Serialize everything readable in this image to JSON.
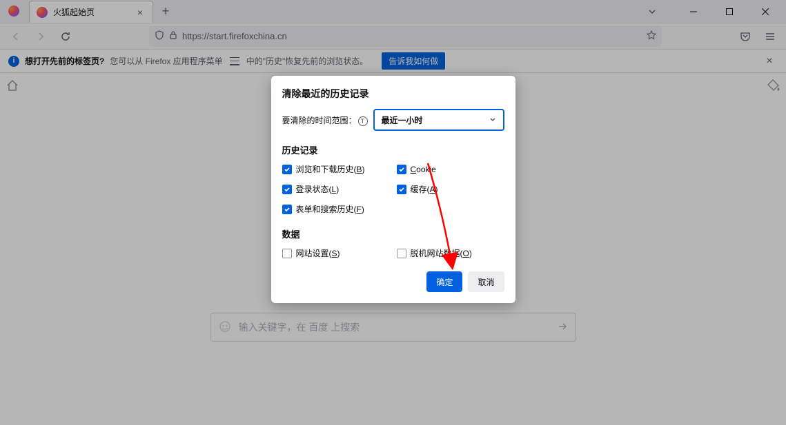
{
  "tab": {
    "title": "火狐起始页"
  },
  "url": "https://start.firefoxchina.cn",
  "notification": {
    "label": "想打开先前的标签页?",
    "text_a": "您可以从 Firefox 应用程序菜单",
    "text_b": "中的\"历史\"恢复先前的浏览状态。",
    "button": "告诉我如何做"
  },
  "search": {
    "placeholder": "输入关键字，在 百度 上搜索"
  },
  "dialog": {
    "title": "清除最近的历史记录",
    "time_label": "要清除的时间范围：",
    "time_shortcut": "T",
    "time_value": "最近一小时",
    "history_section": "历史记录",
    "data_section": "数据",
    "cb_browsing": "浏览和下载历史",
    "cb_browsing_key": "B",
    "cb_cookie": "Cookie",
    "cb_login": "登录状态",
    "cb_login_key": "L",
    "cb_cache": "缓存",
    "cb_cache_key": "A",
    "cb_form": "表单和搜索历史",
    "cb_form_key": "F",
    "cb_site": "网站设置",
    "cb_site_key": "S",
    "cb_offline": "脱机网站数据",
    "cb_offline_key": "O",
    "ok": "确定",
    "cancel": "取消"
  }
}
